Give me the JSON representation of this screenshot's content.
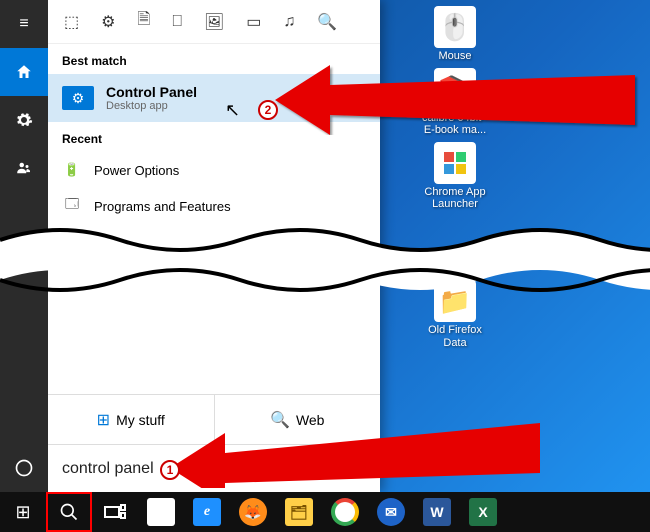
{
  "desktop": {
    "icons": [
      {
        "label": "Mouse",
        "glyph": "🖱️"
      },
      {
        "label": "calibre 64bit - E-book ma...",
        "glyph": "📚"
      },
      {
        "label": "Chrome App Launcher",
        "glyph": "⬜"
      },
      {
        "label": "Old Firefox Data",
        "glyph": "📁"
      }
    ]
  },
  "start": {
    "filters": [
      "⬚",
      "⚙",
      "🗎",
      "⎕",
      "🖼",
      "▭",
      "♫",
      "🔍"
    ],
    "sections": {
      "best_match_label": "Best match",
      "recent_label": "Recent"
    },
    "best_match": {
      "title": "Control Panel",
      "sub": "Desktop app"
    },
    "recent": [
      {
        "label": "Power Options",
        "glyph": "🔋"
      },
      {
        "label": "Programs and Features",
        "glyph": "🗔"
      }
    ],
    "tabs": {
      "my_stuff": "My stuff",
      "web": "Web"
    },
    "search_value": "control panel"
  },
  "annotations": {
    "badge1": "1",
    "badge2": "2"
  },
  "taskbar": {
    "items": [
      "start",
      "search",
      "taskview",
      "store",
      "ie",
      "firefox",
      "explorer",
      "chrome",
      "thunderbird",
      "word",
      "excel"
    ]
  }
}
